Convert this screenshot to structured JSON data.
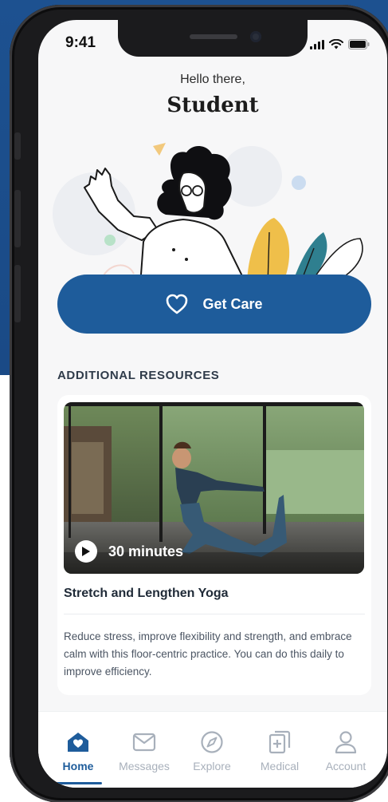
{
  "status_bar": {
    "time": "9:41"
  },
  "header": {
    "greeting": "Hello there,",
    "name": "Student"
  },
  "cta": {
    "label": "Get Care",
    "icon": "heart-outline-icon"
  },
  "resources": {
    "section_title": "ADDITIONAL RESOURCES",
    "card": {
      "duration": "30 minutes",
      "title": "Stretch and Lengthen Yoga",
      "description": "Reduce stress, improve flexibility and strength, and embrace calm with this floor-centric practice. You can do this daily to improve efficiency."
    }
  },
  "tabbar": {
    "tabs": [
      {
        "label": "Home",
        "icon": "home-heart-icon",
        "active": true
      },
      {
        "label": "Messages",
        "icon": "mail-icon",
        "active": false
      },
      {
        "label": "Explore",
        "icon": "compass-icon",
        "active": false
      },
      {
        "label": "Medical",
        "icon": "medical-file-icon",
        "active": false
      },
      {
        "label": "Account",
        "icon": "user-icon",
        "active": false
      }
    ]
  },
  "colors": {
    "primary": "#1e5c9b",
    "background_top": "#1d5190",
    "tab_inactive": "#a8b0bb"
  }
}
